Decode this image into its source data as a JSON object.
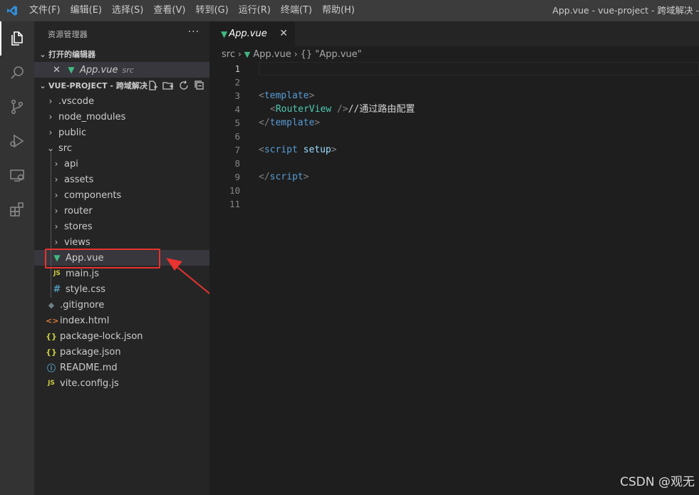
{
  "titlebar": {
    "menu": [
      "文件(F)",
      "编辑(E)",
      "选择(S)",
      "查看(V)",
      "转到(G)",
      "运行(R)",
      "终端(T)",
      "帮助(H)"
    ],
    "window_title": "App.vue - vue-project - 跨域解决 - "
  },
  "activity": [
    "explorer-icon",
    "search-icon",
    "source-control-icon",
    "run-debug-icon",
    "remote-explorer-icon",
    "extensions-icon"
  ],
  "sidebar": {
    "title": "资源管理器",
    "more": "···",
    "open_editors_label": "打开的编辑器",
    "open_editor": {
      "name": "App.vue",
      "dir": "src",
      "close": "✕"
    },
    "project_label": "VUE-PROJECT - 跨域解决",
    "tree": [
      {
        "label": ".vscode",
        "kind": "folder"
      },
      {
        "label": "node_modules",
        "kind": "folder"
      },
      {
        "label": "public",
        "kind": "folder"
      },
      {
        "label": "src",
        "kind": "folder-open"
      },
      {
        "label": "api",
        "kind": "folder"
      },
      {
        "label": "assets",
        "kind": "folder"
      },
      {
        "label": "components",
        "kind": "folder"
      },
      {
        "label": "router",
        "kind": "folder"
      },
      {
        "label": "stores",
        "kind": "folder"
      },
      {
        "label": "views",
        "kind": "folder"
      },
      {
        "label": "App.vue",
        "kind": "vue"
      },
      {
        "label": "main.js",
        "kind": "js"
      },
      {
        "label": "style.css",
        "kind": "css"
      },
      {
        "label": ".gitignore",
        "kind": "git"
      },
      {
        "label": "index.html",
        "kind": "html"
      },
      {
        "label": "package-lock.json",
        "kind": "json"
      },
      {
        "label": "package.json",
        "kind": "json"
      },
      {
        "label": "README.md",
        "kind": "info"
      },
      {
        "label": "vite.config.js",
        "kind": "js"
      }
    ]
  },
  "icons": {
    "js": "JS",
    "json": "{}",
    "css": "#",
    "html": "<>",
    "info": "ⓘ",
    "git": "◆",
    "vue": "▼"
  },
  "editor": {
    "tab_label": "App.vue",
    "tab_close": "✕",
    "breadcrumb": [
      "src",
      "App.vue",
      "{} \"App.vue\""
    ],
    "line_numbers": [
      "1",
      "2",
      "3",
      "4",
      "5",
      "6",
      "7",
      "8",
      "9",
      "10",
      "11"
    ],
    "code": {
      "l3_open": "<",
      "l3_tag": "template",
      "l3_close": ">",
      "l4_open": "<",
      "l4_comp": "RouterView",
      "l4_close": " />",
      "l4_comment": "//通过路由配置",
      "l5_open": "</",
      "l5_tag": "template",
      "l5_close": ">",
      "l7_open": "<",
      "l7_tag": "script",
      "l7_attr": "setup",
      "l7_close": ">",
      "l9_open": "</",
      "l9_tag": "script",
      "l9_close": ">"
    }
  },
  "watermark": "CSDN @观无",
  "colors": {
    "vue_green": "#41b883",
    "highlight_red": "#e8332e",
    "keyword_blue": "#569cd6",
    "component_teal": "#4ec9b0"
  }
}
